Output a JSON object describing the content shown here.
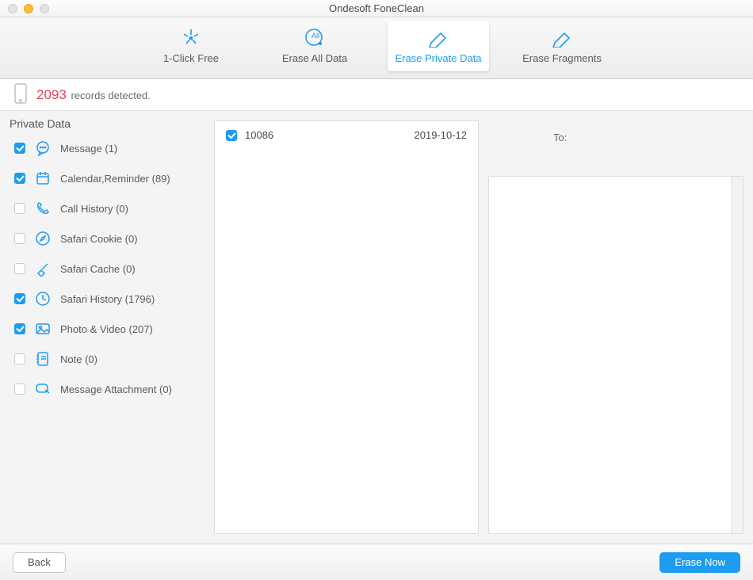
{
  "window": {
    "title": "Ondesoft FoneClean"
  },
  "tabs": [
    {
      "label": "1-Click Free",
      "selected": false,
      "icon": "click-icon"
    },
    {
      "label": "Erase All Data",
      "selected": false,
      "icon": "erase-all-icon"
    },
    {
      "label": "Erase Private Data",
      "selected": true,
      "icon": "erase-private-icon"
    },
    {
      "label": "Erase Fragments",
      "selected": false,
      "icon": "erase-fragments-icon"
    }
  ],
  "records": {
    "count": "2093",
    "suffix": "records detected."
  },
  "sidebar": {
    "title": "Private Data",
    "items": [
      {
        "label": "Message (1)",
        "checked": true,
        "icon": "message-icon"
      },
      {
        "label": "Calendar,Reminder (89)",
        "checked": true,
        "icon": "calendar-icon"
      },
      {
        "label": "Call History (0)",
        "checked": false,
        "icon": "call-icon"
      },
      {
        "label": "Safari Cookie (0)",
        "checked": false,
        "icon": "compass-icon"
      },
      {
        "label": "Safari Cache (0)",
        "checked": false,
        "icon": "brush-icon"
      },
      {
        "label": "Safari History (1796)",
        "checked": true,
        "icon": "clock-icon"
      },
      {
        "label": "Photo & Video (207)",
        "checked": true,
        "icon": "photo-icon"
      },
      {
        "label": "Note (0)",
        "checked": false,
        "icon": "note-icon"
      },
      {
        "label": "Message Attachment (0)",
        "checked": false,
        "icon": "attachment-icon"
      }
    ]
  },
  "messages": [
    {
      "sender": "10086",
      "date": "2019-10-12",
      "checked": true
    }
  ],
  "detail": {
    "to_label": "To:"
  },
  "footer": {
    "back": "Back",
    "erase": "Erase Now"
  },
  "colors": {
    "accent": "#1e9cf0",
    "danger": "#e74455"
  }
}
